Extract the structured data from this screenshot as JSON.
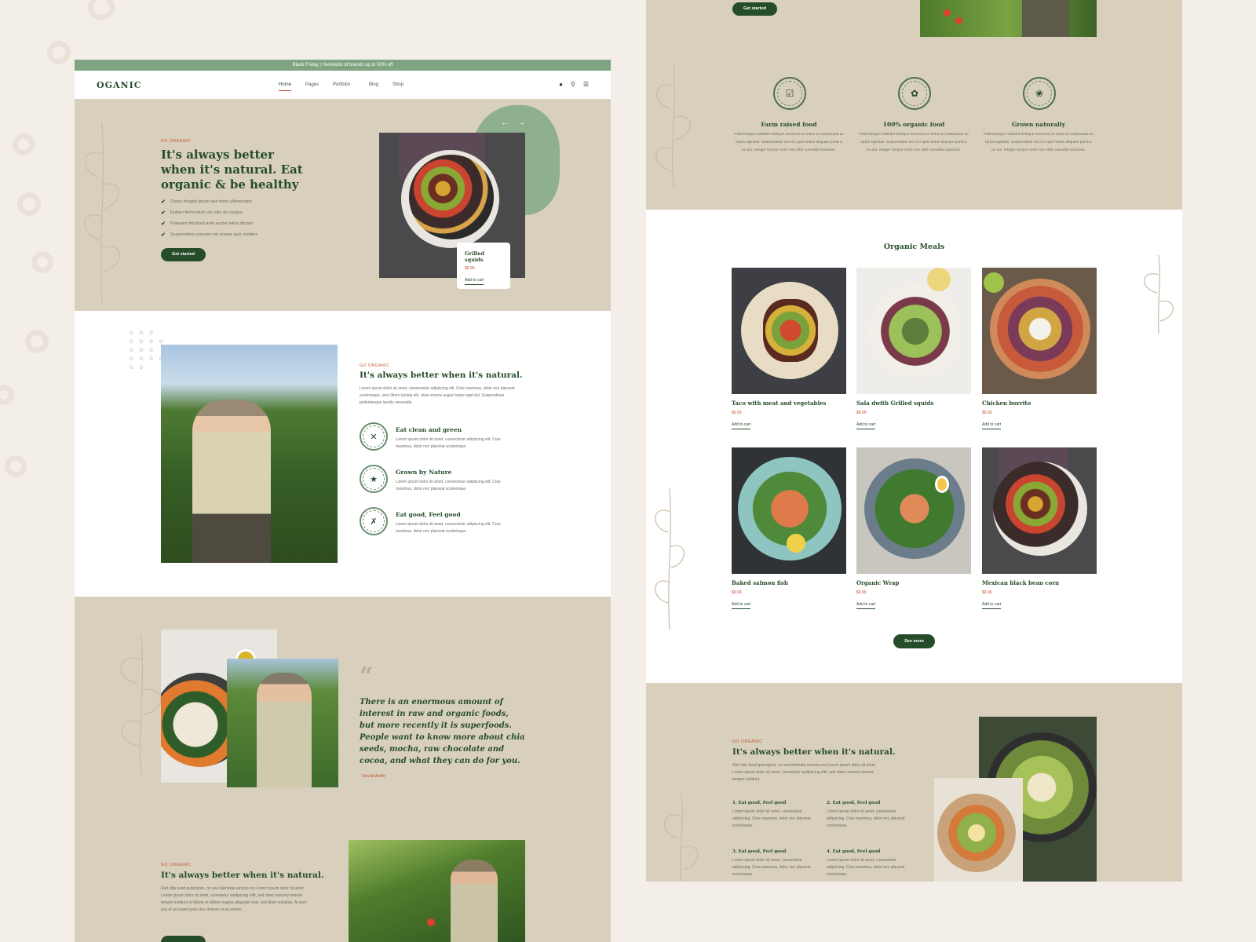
{
  "promo": {
    "text": "Black Friday | Hundreds of brands up to 50% off"
  },
  "nav": {
    "logo": "OGANIC",
    "items": [
      "Home",
      "Pages",
      "Portfolio",
      "Blog",
      "Shop"
    ]
  },
  "hero": {
    "eyebrow": "GO ORGANIC",
    "title": "It's always better when it's natural. Eat organic & be healthy",
    "bullets": [
      "Donec feugiat ipsum sed enim ullamcorper",
      "Nullam fermentum vel odio ac congue",
      "Praesent tincidunt ante auctor tellus dictum",
      "Suspendisse posuere vel massa quis sodales"
    ],
    "cta": "Get started",
    "product": {
      "name": "Grilled squids",
      "price": "$9.99",
      "add": "Add to cart"
    }
  },
  "about": {
    "eyebrow": "GO ORGANIC",
    "title": "It's always better when it's natural.",
    "body": "Lorem ipsum dolor sit amet, consectetur adipiscing elit. Cras maximus, dolor nec placerat scelerisque, urna libero lacinia elit, vitae viverra augue turpis eget dui. Suspendisse pellentesque iaculis venenatis.",
    "features": [
      {
        "title": "Eat clean and green",
        "text": "Lorem ipsum dolor sit amet, consectetur adipiscing elit. Cras maximus, dolor nec placerat scelerisque."
      },
      {
        "title": "Grown by Nature",
        "text": "Lorem ipsum dolor sit amet, consectetur adipiscing elit. Cras maximus, dolor nec placerat scelerisque."
      },
      {
        "title": "Eat good, Feel good",
        "text": "Lorem ipsum dolor sit amet, consectetur adipiscing elit. Cras maximus, dolor nec placerat scelerisque."
      }
    ]
  },
  "quote": {
    "text": "There is an enormous amount of interest in raw and organic foods, but more recently it is superfoods. People want to know more about chia seeds, mocha, raw chocolate and cocoa, and what they can do for you.",
    "author": "- David Wolfe"
  },
  "bottom_left": {
    "eyebrow": "GO ORGANIC",
    "title": "It's always better when it's natural.",
    "body": "Stet clita kasd gubergren, no sea takimata sanctus est Lorem ipsum dolor sit amet. Lorem ipsum dolor sit amet, consetetur sadipscing elitr, sed diam nonumy eirmod tempor invidunt ut labore et dolore magna aliquyam erat, sed diam voluptua. At vero eos et accusam justo duo dolores et ea rebum."
  },
  "right_top": {
    "cta": "Get started"
  },
  "benefits": [
    {
      "badge": "FARM RAISED",
      "title": "Farm raised food",
      "text": "Pellentesque habitant tristique senectus et netus et malesuada ac turpis egestas. Suspendisse vel orci quis metus aliquam porta a eu dui. Integer tempor enim non nibh convallis maximus."
    },
    {
      "badge": "100% ORGANIC",
      "title": "100% organic food",
      "text": "Pellentesque habitant tristique senectus et netus et malesuada ac turpis egestas. Suspendisse vel orci quis metus aliquam porta a eu dui. Integer tempor enim non nibh convallis maximus."
    },
    {
      "badge": "100% NATURAL",
      "title": "Grown naturally",
      "text": "Pellentesque habitant tristique senectus et netus et malesuada ac turpis egestas. Suspendisse vel orci quis metus aliquam porta a eu dui. Integer tempor enim non nibh convallis maximus."
    }
  ],
  "meals": {
    "title": "Organic Meals",
    "items": [
      {
        "name": "Taco with meat and vegetables",
        "price": "$9.99",
        "add": "Add to cart"
      },
      {
        "name": "Sala dwith Grilled squids",
        "price": "$9.99",
        "add": "Add to cart"
      },
      {
        "name": "Chicken burrito",
        "price": "$9.90",
        "add": "Add to cart"
      },
      {
        "name": "Baked salmon fish",
        "price": "$9.99",
        "add": "Add to cart"
      },
      {
        "name": "Organic Wrap",
        "price": "$9.99",
        "add": "Add to cart"
      },
      {
        "name": "Mexican black bean corn",
        "price": "$9.90",
        "add": "Add to cart"
      }
    ],
    "see_more": "See more"
  },
  "bottom_right": {
    "eyebrow": "GO ORGANIC",
    "title": "It's always better when it's natural.",
    "body": "Stet clita kasd gubergren, no sea takimata sanctus est Lorem ipsum dolor sit amet. Lorem ipsum dolor sit amet, consetetur sadipscing elitr, sed diam nonumy eirmod tempor invidunt.",
    "steps": [
      {
        "title": "1. Eat good, Feel good",
        "text": "Lorem ipsum dolor sit amet, consectetur adipiscing. Cras maximus, dolor nec placerat scelerisque."
      },
      {
        "title": "2. Eat good, Feel good",
        "text": "Lorem ipsum dolor sit amet, consectetur adipiscing. Cras maximus, dolor nec placerat scelerisque."
      },
      {
        "title": "3. Eat good, Feel good",
        "text": "Lorem ipsum dolor sit amet, consectetur adipiscing. Cras maximus, dolor nec placerat scelerisque."
      },
      {
        "title": "4. Eat good, Feel good",
        "text": "Lorem ipsum dolor sit amet, consectetur adipiscing. Cras maximus, dolor nec placerat scelerisque."
      }
    ]
  },
  "colors": {
    "brand_green": "#264d2a",
    "accent": "#c2502e",
    "beige": "#d9cfbd",
    "promo_bar": "#7fa482"
  },
  "icons": [
    "user-icon",
    "search-icon",
    "menu-icon",
    "arrow-left-icon",
    "arrow-right-icon",
    "check-icon",
    "quote-icon"
  ]
}
